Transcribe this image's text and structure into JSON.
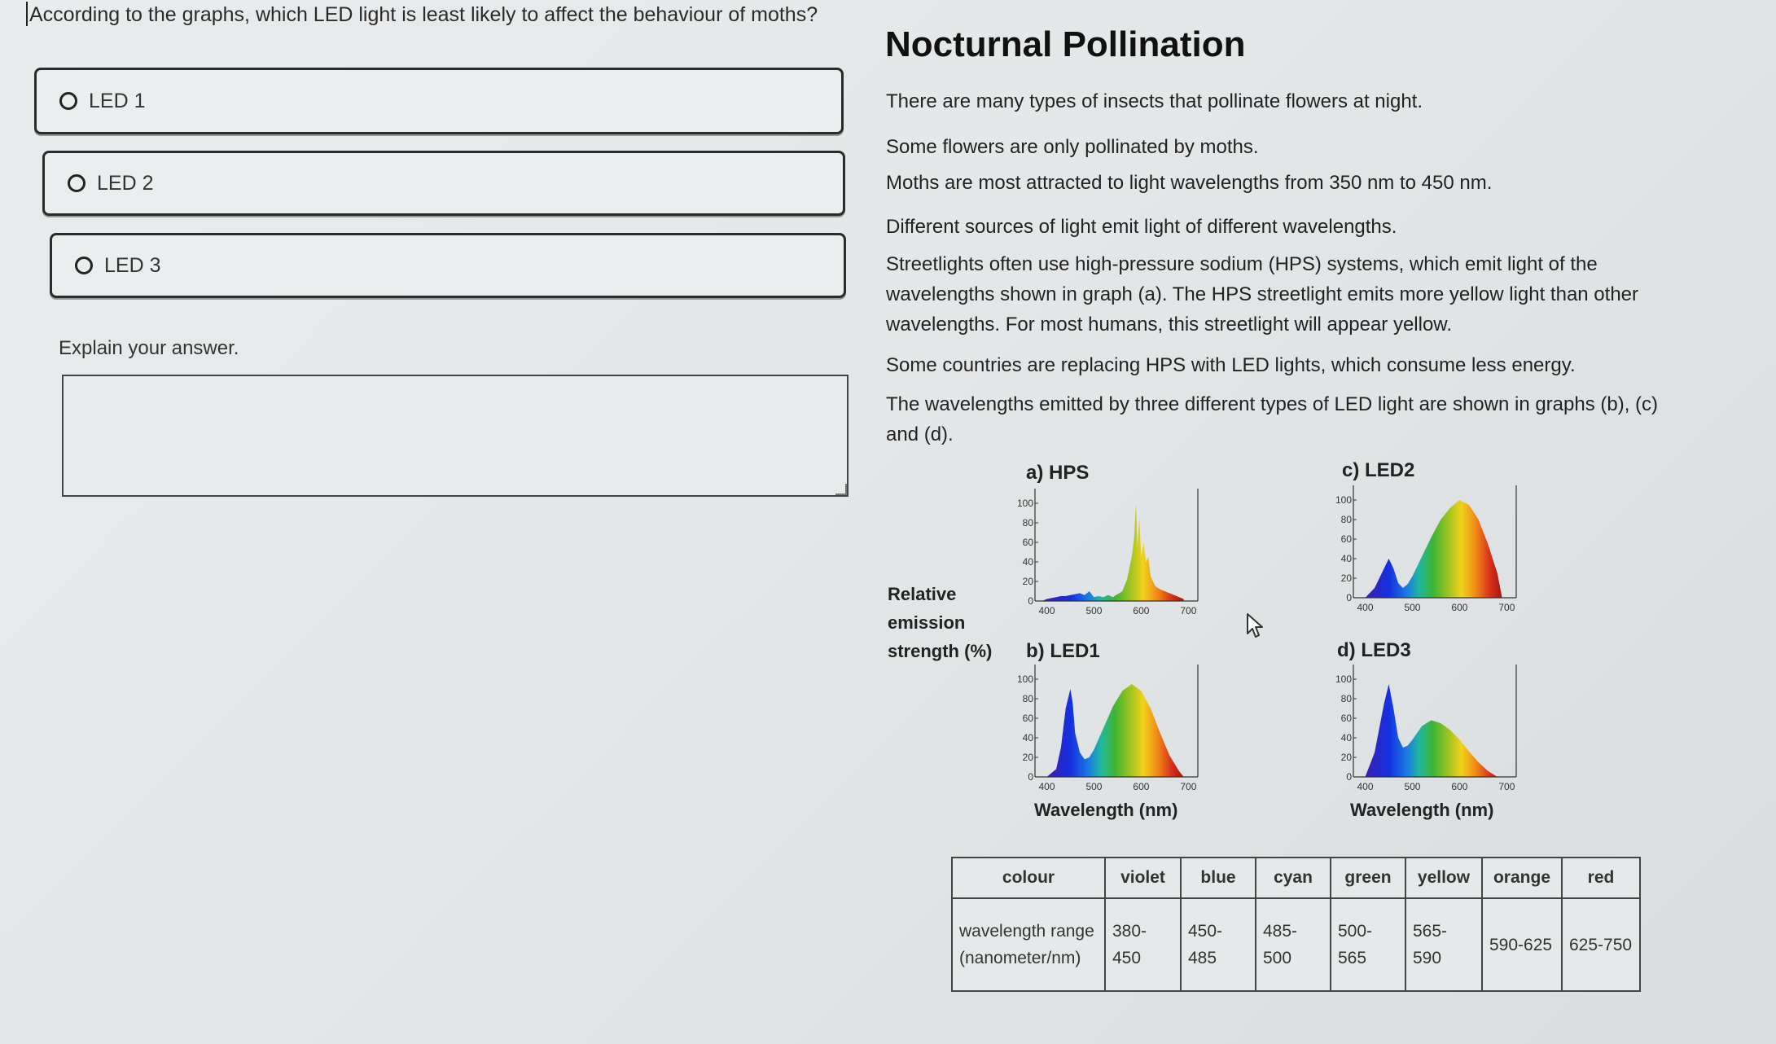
{
  "question": "According to the graphs, which LED light is least likely to affect the behaviour of moths?",
  "options": [
    {
      "label": "LED 1"
    },
    {
      "label": "LED 2"
    },
    {
      "label": "LED 3"
    }
  ],
  "explain_label": "Explain your answer.",
  "answer_value": "",
  "article": {
    "title": "Nocturnal Pollination",
    "paragraphs": [
      "There are many types of insects that pollinate flowers at night.",
      "Some flowers are only pollinated by moths.",
      "Moths are most attracted to light wavelengths from 350 nm to 450 nm.",
      "Different sources of light emit light of different wavelengths.",
      "Streetlights often use high-pressure sodium (HPS) systems, which emit light of the wavelengths shown in graph (a). The HPS streetlight emits more yellow light than other wavelengths. For most humans, this streetlight will appear yellow.",
      "Some countries are replacing HPS with LED lights, which consume less energy.",
      "The wavelengths emitted by three different types of LED light are shown in graphs (b), (c) and (d)."
    ]
  },
  "y_label": "Relative emission strength (%)",
  "x_label": "Wavelength (nm)",
  "chart_data": [
    {
      "type": "area",
      "title": "a) HPS",
      "x": [
        390,
        400,
        410,
        420,
        430,
        440,
        450,
        460,
        470,
        480,
        490,
        500,
        510,
        520,
        530,
        540,
        550,
        560,
        570,
        580,
        585,
        589,
        592,
        596,
        600,
        605,
        610,
        615,
        620,
        630,
        640,
        650,
        660,
        670,
        680,
        690
      ],
      "y": [
        0,
        2,
        3,
        4,
        5,
        5,
        6,
        7,
        8,
        6,
        10,
        4,
        5,
        4,
        6,
        4,
        7,
        10,
        22,
        45,
        65,
        100,
        55,
        85,
        45,
        60,
        40,
        45,
        25,
        15,
        12,
        10,
        8,
        6,
        4,
        2
      ],
      "xlim": [
        375,
        720
      ],
      "ylim": [
        0,
        100
      ],
      "xticks": [
        400,
        500,
        600,
        700
      ],
      "yticks": [
        0,
        20,
        40,
        60,
        80,
        100
      ]
    },
    {
      "type": "area",
      "title": "b) LED1",
      "x": [
        400,
        420,
        430,
        440,
        450,
        455,
        460,
        470,
        480,
        490,
        500,
        520,
        540,
        560,
        580,
        600,
        620,
        640,
        660,
        680,
        690
      ],
      "y": [
        0,
        8,
        30,
        70,
        90,
        75,
        45,
        25,
        18,
        20,
        28,
        50,
        72,
        88,
        95,
        88,
        70,
        45,
        22,
        6,
        0
      ],
      "xlim": [
        375,
        720
      ],
      "ylim": [
        0,
        100
      ],
      "xticks": [
        400,
        500,
        600,
        700
      ],
      "yticks": [
        0,
        20,
        40,
        60,
        80,
        100
      ]
    },
    {
      "type": "area",
      "title": "c) LED2",
      "x": [
        400,
        420,
        440,
        450,
        460,
        470,
        480,
        490,
        500,
        520,
        540,
        560,
        580,
        600,
        620,
        640,
        660,
        680,
        690
      ],
      "y": [
        0,
        10,
        30,
        40,
        30,
        15,
        10,
        14,
        22,
        42,
        62,
        80,
        92,
        100,
        95,
        80,
        55,
        25,
        0
      ],
      "xlim": [
        375,
        720
      ],
      "ylim": [
        0,
        100
      ],
      "xticks": [
        400,
        500,
        600,
        700
      ],
      "yticks": [
        0,
        20,
        40,
        60,
        80,
        100
      ]
    },
    {
      "type": "area",
      "title": "d) LED3",
      "x": [
        400,
        420,
        440,
        450,
        460,
        470,
        480,
        490,
        500,
        520,
        540,
        560,
        580,
        600,
        620,
        640,
        660,
        680
      ],
      "y": [
        0,
        25,
        75,
        95,
        70,
        40,
        30,
        32,
        38,
        52,
        58,
        55,
        48,
        38,
        26,
        15,
        6,
        0
      ],
      "xlim": [
        375,
        720
      ],
      "ylim": [
        0,
        100
      ],
      "xticks": [
        400,
        500,
        600,
        700
      ],
      "yticks": [
        0,
        20,
        40,
        60,
        80,
        100
      ]
    }
  ],
  "colour_table": {
    "header_label": "colour",
    "row_label": "wavelength range (nanometer/nm)",
    "colours": [
      "violet",
      "blue",
      "cyan",
      "green",
      "yellow",
      "orange",
      "red"
    ],
    "ranges": [
      "380-450",
      "450-485",
      "485-500",
      "500-565",
      "565-590",
      "590-625",
      "625-750"
    ]
  }
}
